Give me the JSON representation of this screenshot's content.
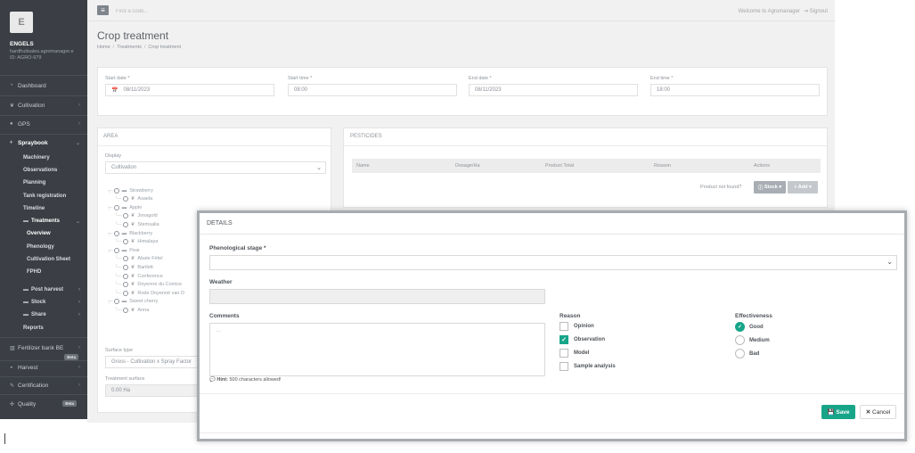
{
  "topbar": {
    "search_placeholder": "Find a code...",
    "welcome": "Welcome to Agromanager",
    "signout": "Signout"
  },
  "sidebar": {
    "avatar_letter": "E",
    "user_name": "ENGELS",
    "user_email": "hardfruitsales.agromanager.e",
    "user_id": "ID: AGRO-979",
    "items": [
      {
        "label": "Dashboard",
        "icon": "dashboard-icon"
      },
      {
        "label": "Cultivation",
        "icon": "leaf-icon"
      },
      {
        "label": "GPS",
        "icon": "map-pin-icon"
      },
      {
        "label": "Spraybook",
        "icon": "spray-icon"
      }
    ],
    "spraybook_sub": [
      "Machinery",
      "Observations",
      "Planning",
      "Tank registration",
      "Timeline"
    ],
    "treatments": {
      "label": "Treatments",
      "sub": [
        "Overview",
        "Phenology",
        "Cultivation Sheet",
        "FPHD"
      ]
    },
    "more_sub": [
      {
        "label": "Post harvest"
      },
      {
        "label": "Stock"
      },
      {
        "label": "Share"
      },
      {
        "label": "Reports"
      }
    ],
    "bottom": [
      {
        "label": "Fertilizer bank BE",
        "badge": "Beta"
      },
      {
        "label": "Harvest"
      },
      {
        "label": "Certification"
      },
      {
        "label": "Quality",
        "badge": "Beta"
      }
    ]
  },
  "page": {
    "title": "Crop treatment",
    "breadcrumb": [
      "Home",
      "Treatments",
      "Crop treatment"
    ]
  },
  "dates": {
    "start_date_label": "Start date *",
    "start_date": "08/11/2023",
    "start_time_label": "Start time *",
    "start_time": "08:00",
    "end_date_label": "End date *",
    "end_date": "08/11/2023",
    "end_time_label": "End time *",
    "end_time": "18:00"
  },
  "area": {
    "header": "AREA",
    "display_label": "Display",
    "display_value": "Cultivation",
    "tree": [
      {
        "label": "Strawberry",
        "level": 0
      },
      {
        "label": "Asaela",
        "level": 1
      },
      {
        "label": "Apple",
        "level": 0
      },
      {
        "label": "Jonagold",
        "level": 1
      },
      {
        "label": "Stemsalia",
        "level": 1
      },
      {
        "label": "Blackberry",
        "level": 0
      },
      {
        "label": "Himalaya",
        "level": 1
      },
      {
        "label": "Pear",
        "level": 0
      },
      {
        "label": "Abate Fétel",
        "level": 1
      },
      {
        "label": "Bartlett",
        "level": 1
      },
      {
        "label": "Conference",
        "level": 1
      },
      {
        "label": "Doyenné du Comice",
        "level": 1
      },
      {
        "label": "Rode Doyenné van D",
        "level": 1
      },
      {
        "label": "Sweet cherry",
        "level": 0
      },
      {
        "label": "Anna",
        "level": 1
      }
    ],
    "surface_type_label": "Surface type",
    "surface_type_value": "Gross - Cultivation x Spray Factor",
    "treatment_surface_label": "Treatment surface",
    "treatment_surface_value": "0.00 Ha"
  },
  "pesticides": {
    "header": "PESTICIDES",
    "columns": [
      "Name",
      "Dosage/Ha",
      "Product Total",
      "Reason",
      "Actions"
    ],
    "not_found": "Product not found?",
    "stock_btn": "Stock",
    "add_btn": "+ Add"
  },
  "modal": {
    "title": "DETAILS",
    "phenological_label": "Phenological stage *",
    "weather_label": "Weather",
    "comments_label": "Comments",
    "comments_placeholder": "...",
    "hint_bold": "Hint:",
    "hint_text": "500 characters allowed!",
    "reason_label": "Reason",
    "reasons": [
      {
        "label": "Opinion",
        "checked": false
      },
      {
        "label": "Observation",
        "checked": true
      },
      {
        "label": "Model",
        "checked": false
      },
      {
        "label": "Sample analysis",
        "checked": false
      }
    ],
    "effectiveness_label": "Effectiveness",
    "effectiveness": [
      {
        "label": "Good",
        "checked": true
      },
      {
        "label": "Medium",
        "checked": false
      },
      {
        "label": "Bad",
        "checked": false
      }
    ],
    "save": "Save",
    "cancel": "Cancel"
  },
  "colors": {
    "accent": "#17a589",
    "sidebar_bg": "#3b3f45"
  }
}
